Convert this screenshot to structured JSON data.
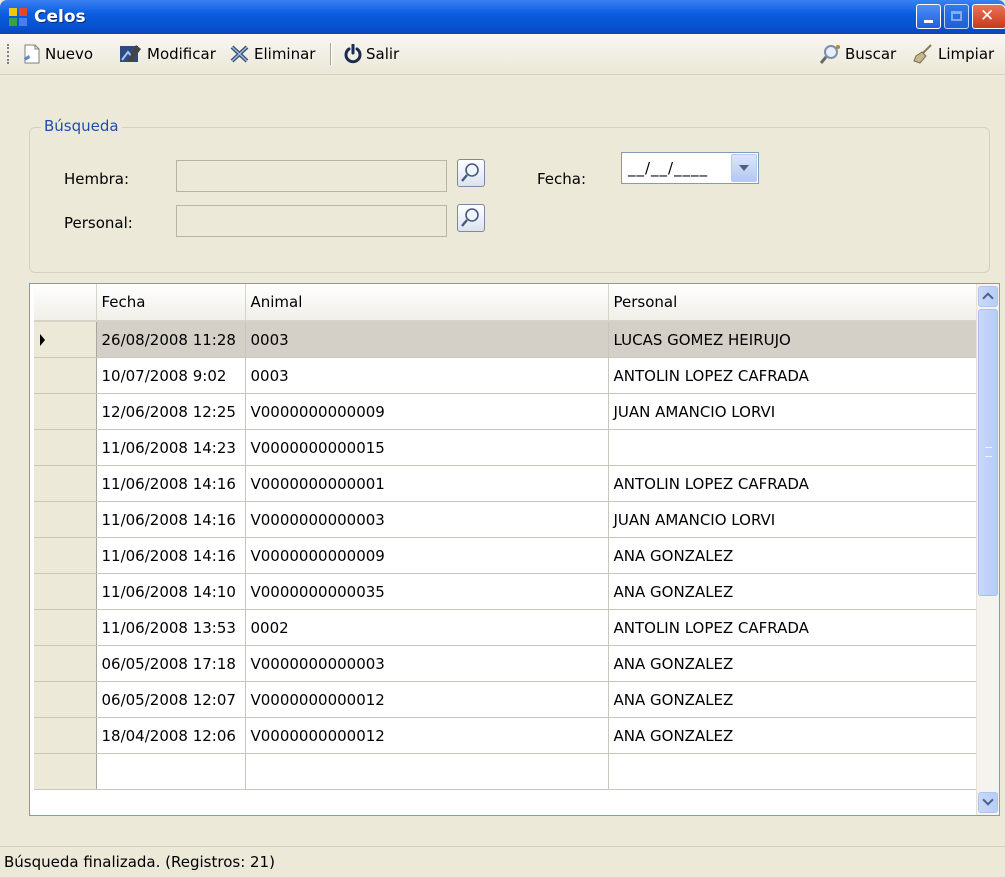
{
  "window": {
    "title": "Celos"
  },
  "toolbar": {
    "nuevo": "Nuevo",
    "modificar": "Modificar",
    "eliminar": "Eliminar",
    "salir": "Salir",
    "buscar": "Buscar",
    "limpiar": "Limpiar"
  },
  "search": {
    "group_label": "Búsqueda",
    "hembra_label": "Hembra:",
    "hembra_value": "",
    "personal_label": "Personal:",
    "personal_value": "",
    "fecha_label": "Fecha:",
    "fecha_value": "__/__/____"
  },
  "grid": {
    "columns": [
      "Fecha",
      "Animal",
      "Personal"
    ],
    "selected_row": 0,
    "rows": [
      {
        "fecha": "26/08/2008 11:28",
        "animal": "0003",
        "personal": "LUCAS GOMEZ HEIRUJO"
      },
      {
        "fecha": "10/07/2008 9:02",
        "animal": "0003",
        "personal": "ANTOLIN LOPEZ CAFRADA"
      },
      {
        "fecha": "12/06/2008 12:25",
        "animal": "V0000000000009",
        "personal": "JUAN AMANCIO LORVI"
      },
      {
        "fecha": "11/06/2008 14:23",
        "animal": "V0000000000015",
        "personal": ""
      },
      {
        "fecha": "11/06/2008 14:16",
        "animal": "V0000000000001",
        "personal": "ANTOLIN LOPEZ CAFRADA"
      },
      {
        "fecha": "11/06/2008 14:16",
        "animal": "V0000000000003",
        "personal": "JUAN AMANCIO LORVI"
      },
      {
        "fecha": "11/06/2008 14:16",
        "animal": "V0000000000009",
        "personal": "ANA GONZALEZ"
      },
      {
        "fecha": "11/06/2008 14:10",
        "animal": "V0000000000035",
        "personal": "ANA GONZALEZ"
      },
      {
        "fecha": "11/06/2008 13:53",
        "animal": "0002",
        "personal": "ANTOLIN LOPEZ CAFRADA"
      },
      {
        "fecha": "06/05/2008 17:18",
        "animal": "V0000000000003",
        "personal": "ANA GONZALEZ"
      },
      {
        "fecha": "06/05/2008 12:07",
        "animal": "V0000000000012",
        "personal": "ANA GONZALEZ"
      },
      {
        "fecha": "18/04/2008 12:06",
        "animal": "V0000000000012",
        "personal": "ANA GONZALEZ"
      }
    ]
  },
  "status": {
    "text": "Búsqueda finalizada. (Registros: 21)"
  }
}
